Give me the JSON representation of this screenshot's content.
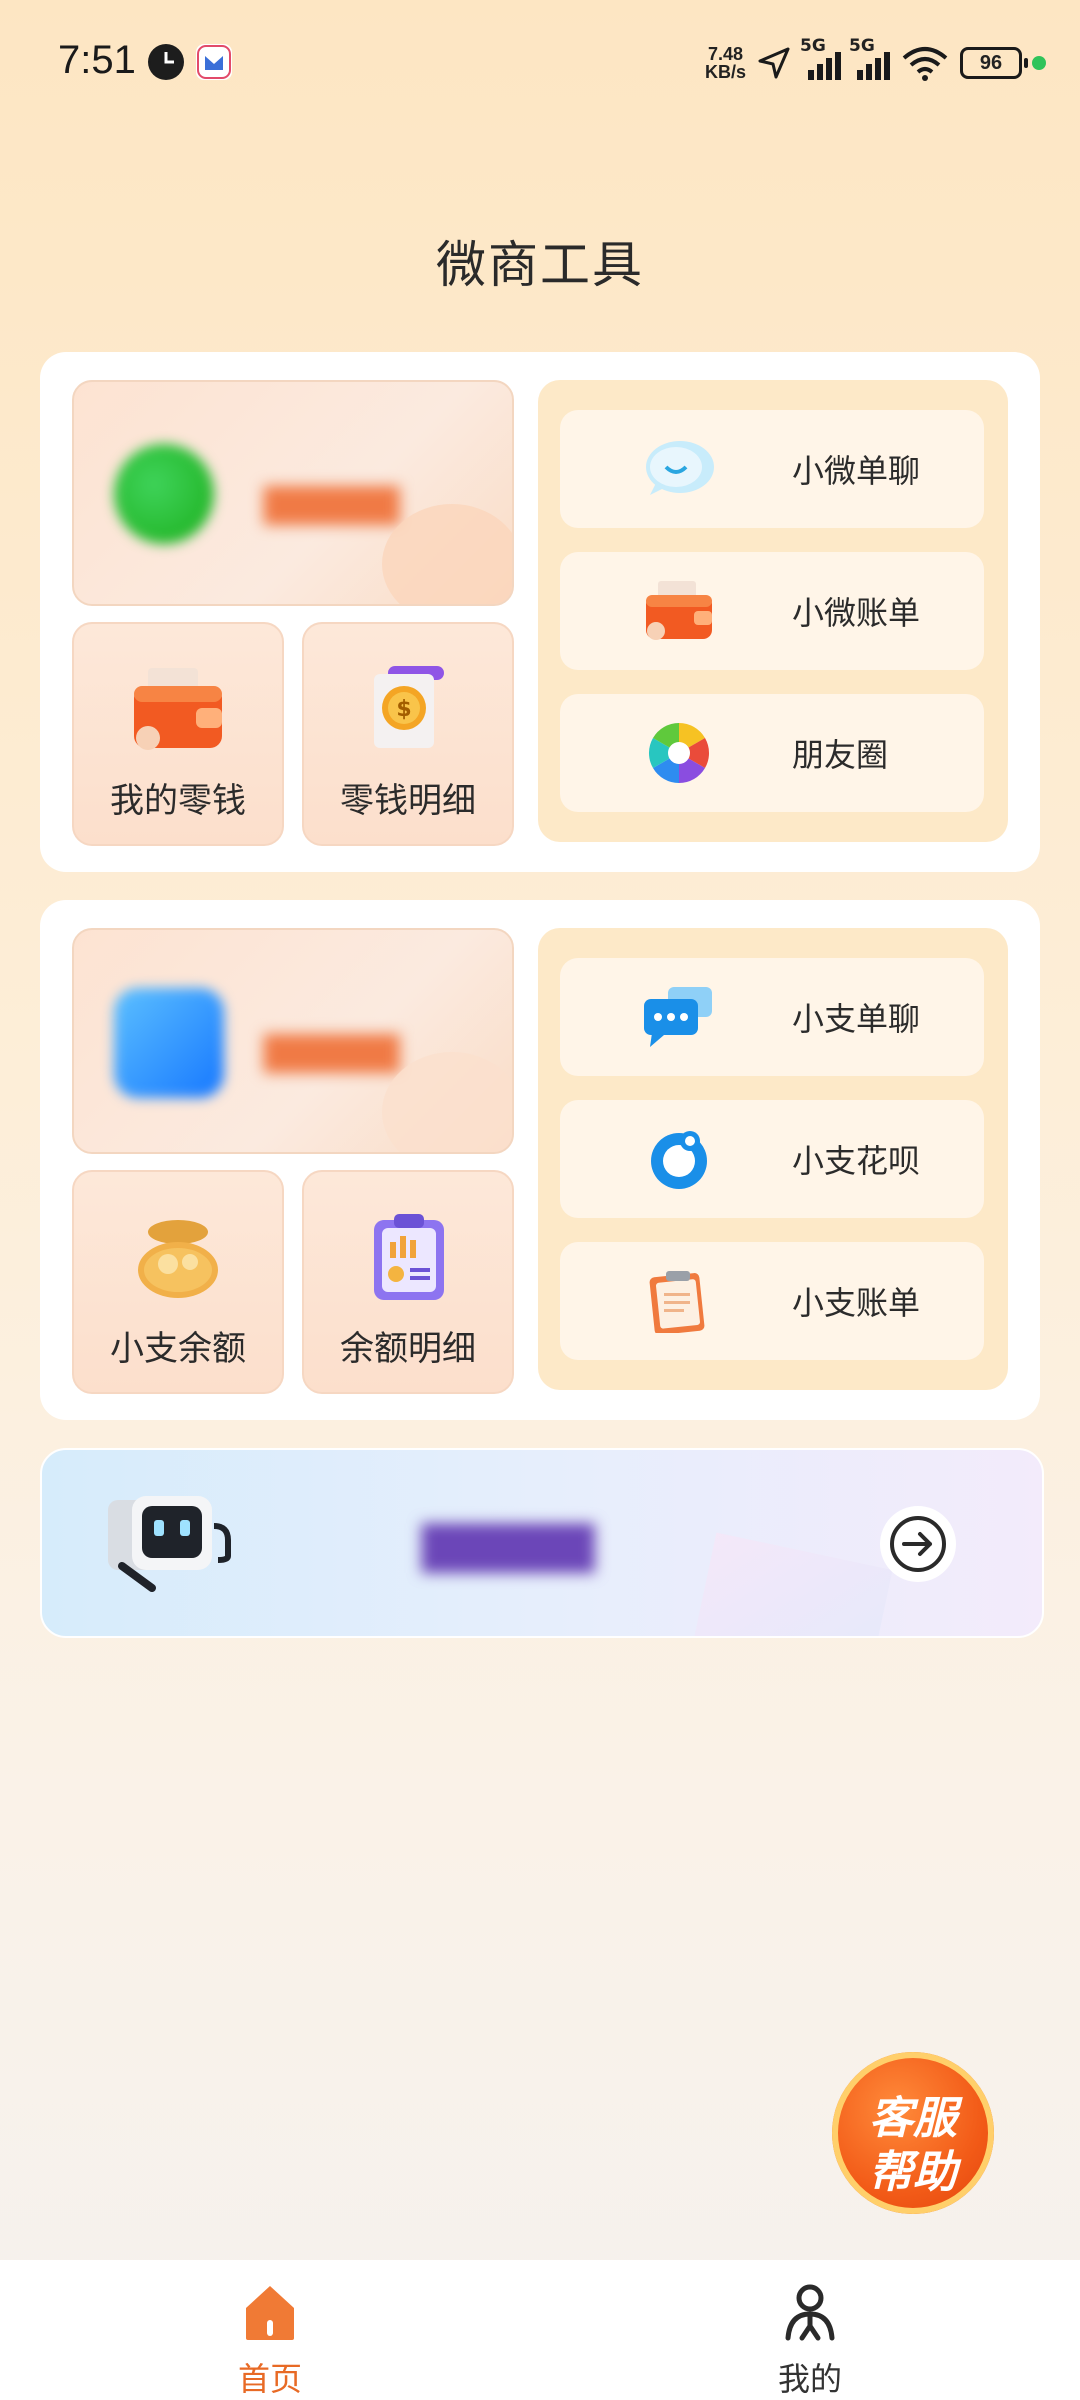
{
  "status_bar": {
    "time": "7:51",
    "net_speed_value": "7.48",
    "net_speed_unit": "KB/s",
    "signal_1_label": "5G",
    "signal_2_label": "5G",
    "battery": "96"
  },
  "page": {
    "title": "微商工具"
  },
  "wechat_section": {
    "mini_tiles": [
      {
        "label": "我的零钱",
        "icon": "wallet-icon"
      },
      {
        "label": "零钱明细",
        "icon": "receipt-coin-icon"
      }
    ],
    "side_items": [
      {
        "label": "小微单聊",
        "icon": "chat-bubble-icon"
      },
      {
        "label": "小微账单",
        "icon": "wallet-icon"
      },
      {
        "label": "朋友圈",
        "icon": "camera-aperture-icon"
      }
    ]
  },
  "alipay_section": {
    "mini_tiles": [
      {
        "label": "小支余额",
        "icon": "money-bag-icon"
      },
      {
        "label": "余额明细",
        "icon": "clipboard-chart-icon"
      }
    ],
    "side_items": [
      {
        "label": "小支单聊",
        "icon": "chat-dots-icon"
      },
      {
        "label": "小支花呗",
        "icon": "huabei-icon"
      },
      {
        "label": "小支账单",
        "icon": "clipboard-icon"
      }
    ]
  },
  "help_button": {
    "line1": "客服",
    "line2": "帮助"
  },
  "bottom_nav": {
    "home_label": "首页",
    "mine_label": "我的"
  },
  "colors": {
    "accent": "#e86a25",
    "side_panel": "#fde9c8",
    "card": "#ffffff"
  }
}
